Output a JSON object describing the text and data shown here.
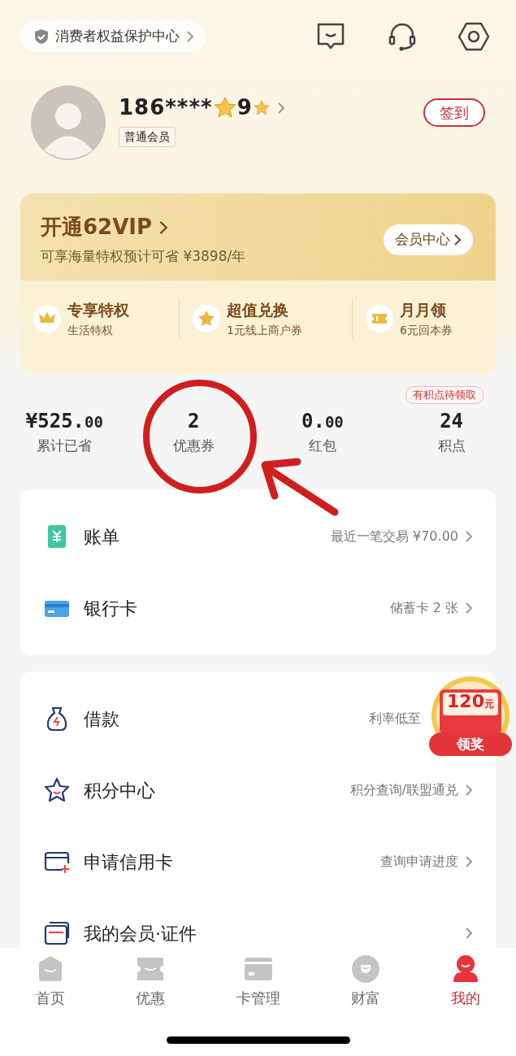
{
  "top_bar": {
    "protection_link": "消费者权益保护中心"
  },
  "profile": {
    "phone": "186****",
    "phone_tail": "9",
    "member_level": "普通会员",
    "checkin_button": "签到"
  },
  "vip_card": {
    "title": "开通62VIP",
    "subtitle": "可享海量特权预计可省  ¥3898/年",
    "center_button": "会员中心",
    "benefits": [
      {
        "kind": "crown",
        "title": "专享特权",
        "desc": "生活特权"
      },
      {
        "kind": "star",
        "title": "超值兑换",
        "desc": "1元线上商户券"
      },
      {
        "kind": "ticket",
        "title": "月月领",
        "desc": "6元回本券"
      }
    ]
  },
  "stats": [
    {
      "value": "¥525.",
      "decimals": "00",
      "label": "累计已省"
    },
    {
      "value": "2",
      "label": "优惠券"
    },
    {
      "value": "0.",
      "decimals": "00",
      "label": "红包"
    },
    {
      "value": "24",
      "label": "积点",
      "badge": "有积点待领取"
    }
  ],
  "menu_groups": [
    [
      {
        "kind": "bill",
        "title": "账单",
        "detail": "最近一笔交易 ¥70.00"
      },
      {
        "kind": "bankcard",
        "title": "银行卡",
        "detail": "储蓄卡 2 张"
      }
    ],
    [
      {
        "kind": "loan",
        "title": "借款",
        "detail": "利率低至"
      },
      {
        "kind": "points",
        "title": "积分中心",
        "detail": "积分查询/联盟通兑"
      },
      {
        "kind": "apply",
        "title": "申请信用卡",
        "detail": "查询申请进度"
      },
      {
        "kind": "membership",
        "title": "我的会员·证件"
      }
    ]
  ],
  "reward_badge": {
    "amount": "120",
    "unit": "元",
    "action": "领奖"
  },
  "bottom_nav": [
    {
      "kind": "home",
      "label": "首页",
      "selected": false
    },
    {
      "kind": "deals",
      "label": "优惠",
      "selected": false
    },
    {
      "kind": "cards",
      "label": "卡管理",
      "selected": false
    },
    {
      "kind": "wealth",
      "label": "财富",
      "selected": false
    },
    {
      "kind": "me",
      "label": "我的",
      "selected": true
    }
  ]
}
